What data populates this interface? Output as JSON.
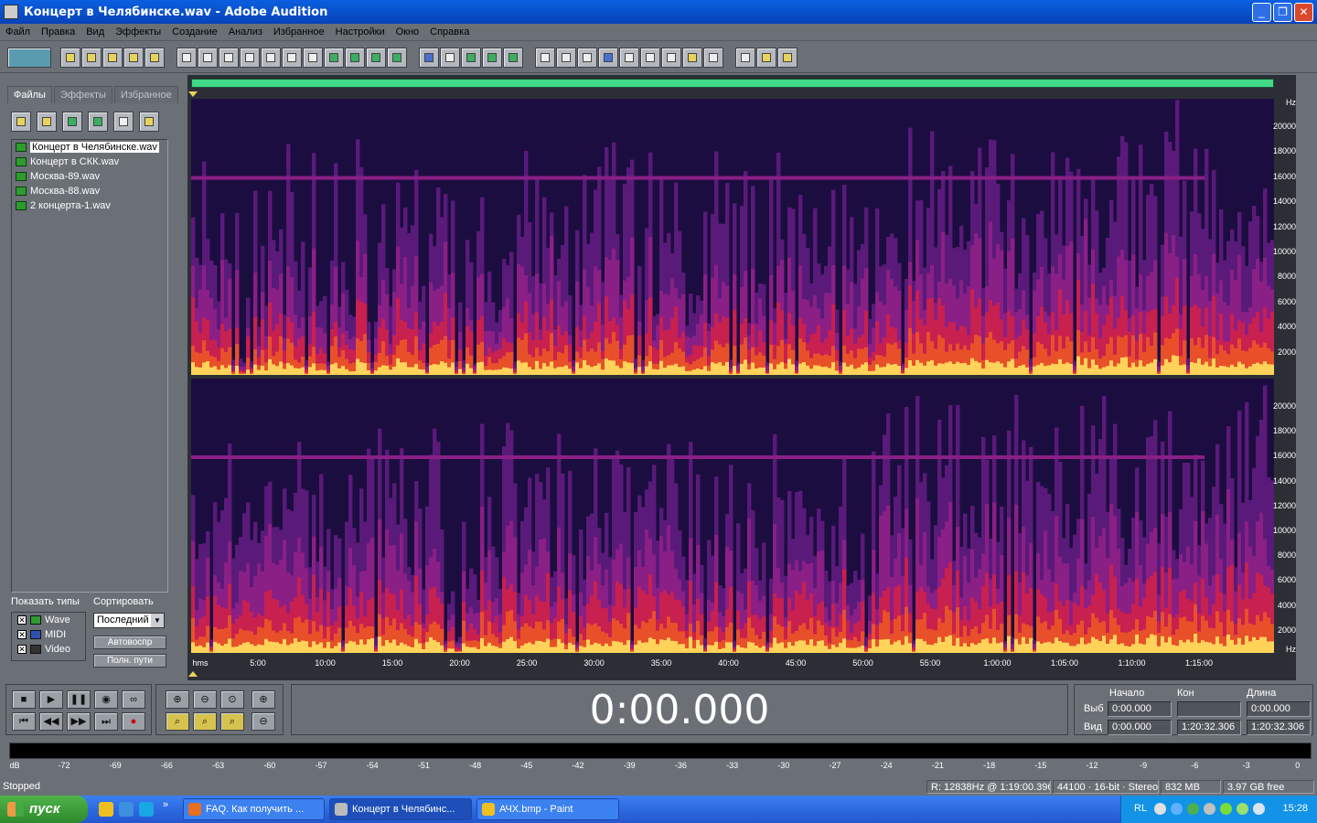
{
  "window": {
    "title": "Концерт в Челябинске.wav - Adobe Audition"
  },
  "menu": [
    "Файл",
    "Правка",
    "Вид",
    "Эффекты",
    "Создание",
    "Анализ",
    "Избранное",
    "Настройки",
    "Окно",
    "Справка"
  ],
  "panel": {
    "tabs": [
      "Файлы",
      "Эффекты",
      "Избранное"
    ],
    "files": [
      "Концерт в Челябинске.wav",
      "Концерт в СКК.wav",
      "Москва-89.wav",
      "Москва-88.wav",
      "2 концерта-1.wav"
    ],
    "show_types_label": "Показать типы",
    "sort_label": "Сортировать",
    "types": [
      "Wave",
      "MIDI",
      "Video"
    ],
    "sort_value": "Последний",
    "btn_autoplay": "Автовоспр",
    "btn_full_paths": "Полн. пути"
  },
  "wave": {
    "hz_unit": "Hz",
    "hz_labels": [
      "20000",
      "18000",
      "16000",
      "14000",
      "12000",
      "10000",
      "8000",
      "6000",
      "4000",
      "2000"
    ],
    "time_unit": "hms",
    "time_labels": [
      "5:00",
      "10:00",
      "15:00",
      "20:00",
      "25:00",
      "30:00",
      "35:00",
      "40:00",
      "45:00",
      "50:00",
      "55:00",
      "1:00:00",
      "1:05:00",
      "1:10:00",
      "1:15:00"
    ]
  },
  "time_display": "0:00.000",
  "selection": {
    "hdr_begin": "Начало",
    "hdr_end": "Кон",
    "hdr_length": "Длина",
    "row_sel": "Выб",
    "row_view": "Вид",
    "sel_begin": "0:00.000",
    "sel_end": "",
    "sel_length": "0:00.000",
    "view_begin": "0:00.000",
    "view_end": "1:20:32.306",
    "view_length": "1:20:32.306"
  },
  "level_meter": {
    "unit": "dB",
    "labels": [
      "-72",
      "-69",
      "-66",
      "-63",
      "-60",
      "-57",
      "-54",
      "-51",
      "-48",
      "-45",
      "-42",
      "-39",
      "-36",
      "-33",
      "-30",
      "-27",
      "-24",
      "-21",
      "-18",
      "-15",
      "-12",
      "-9",
      "-6",
      "-3",
      "0"
    ]
  },
  "status": {
    "state": "Stopped",
    "cursor": "R: 12838Hz @ 1:19:00.396",
    "format": "44100 · 16-bit · Stereo",
    "size": "832 MB",
    "free": "3.97 GB free"
  },
  "taskbar": {
    "start": "пуск",
    "tasks": [
      "FAQ. Как получить ...",
      "Концерт в Челябинс...",
      "АЧХ.bmp - Paint"
    ],
    "lang": "RL",
    "clock": "15:28"
  }
}
